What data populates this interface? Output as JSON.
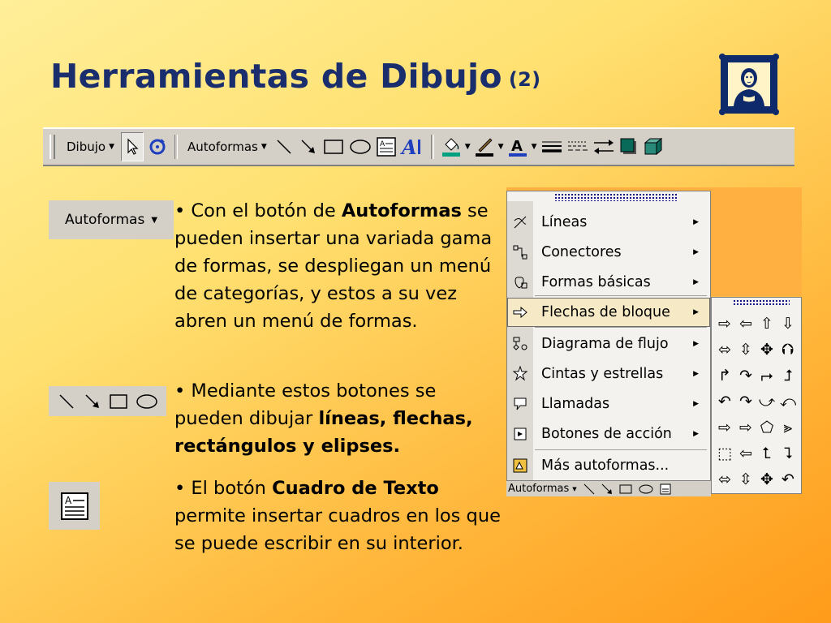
{
  "slide": {
    "title": "Herramientas de Dibujo",
    "title_suffix": "(2)"
  },
  "toolbar": {
    "dibujo_label": "Dibujo",
    "autoformas_label": "Autoformas",
    "buttons": [
      "select-arrow",
      "free-rotate",
      "line",
      "arrow",
      "rectangle",
      "oval",
      "text-box",
      "wordart",
      "fill-color",
      "line-color",
      "font-color",
      "line-style",
      "dash-style",
      "arrow-style",
      "shadow",
      "3d"
    ]
  },
  "side": {
    "autoformas_label": "Autoformas"
  },
  "paragraphs": {
    "p1_bullet": "• Con el botón de ",
    "p1_bold": "Autoformas",
    "p1_rest": " se pueden insertar una variada gama de formas, se despliegan un menú de categorías, y estos a su vez abren un menú de formas.",
    "p2_text": "• Mediante estos botones se pueden dibujar ",
    "p2_bold": "líneas, flechas, rectángulos y elipses.",
    "p3_bullet": "• El botón ",
    "p3_bold": "Cuadro de Texto",
    "p3_rest": " permite insertar cuadros en los que se puede escribir en su interior."
  },
  "menu": {
    "items": [
      {
        "label": "Líneas",
        "icon": "lines-icon"
      },
      {
        "label": "Conectores",
        "icon": "connectors-icon"
      },
      {
        "label": "Formas básicas",
        "icon": "basic-shapes-icon"
      },
      {
        "label": "Flechas de bloque",
        "icon": "block-arrows-icon"
      },
      {
        "label": "Diagrama de flujo",
        "icon": "flowchart-icon"
      },
      {
        "label": "Cintas y estrellas",
        "icon": "stars-banners-icon"
      },
      {
        "label": "Llamadas",
        "icon": "callouts-icon"
      },
      {
        "label": "Botones de acción",
        "icon": "action-buttons-icon"
      },
      {
        "label": "Más autoformas...",
        "icon": "more-autoshapes-icon"
      }
    ],
    "highlighted_index": 3,
    "mini_toolbar_label": "Autoformas"
  },
  "submenu": {
    "shapes": [
      "⇨",
      "⇦",
      "⇧",
      "⇩",
      "⬄",
      "⇳",
      "✥",
      "⮉",
      "↱",
      "↷",
      "⮣",
      "⮥",
      "↶",
      "↷",
      "⤻",
      "⤺",
      "⇨",
      "⇨",
      "⬠",
      "⪢",
      "⬚",
      "⇦",
      "⮤",
      "⮧",
      "⬄",
      "⇳",
      "✥",
      "↶"
    ]
  },
  "colors": {
    "title": "#1a2e6e",
    "toolbar_bg": "#d4d0c8",
    "menu_highlight": "#f6e9c5"
  }
}
